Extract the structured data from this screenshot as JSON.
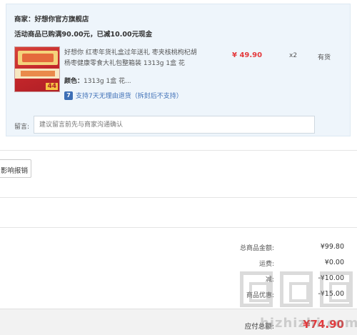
{
  "shop": {
    "name": "商家：好想你官方旗舰店",
    "promo": "活动商品已购满90.00元，已减10.00元现金"
  },
  "item": {
    "thumb_tag": "44",
    "title": "好想你 红枣年货礼盒过年送礼 枣夹核桃枸杞胡杨枣健康零食大礼包整箱装 1313g 1盒 花",
    "price": "¥ 49.90",
    "quantity": "x2",
    "stock": "有货",
    "color_label": "颜色：",
    "color_value": "1313g 1盒 花...",
    "return_icon": "7",
    "return_policy": "支持7天无理由退货（拆封后不支持）"
  },
  "message": {
    "label": "留言:",
    "placeholder": "建议留言前先与商家沟通确认"
  },
  "invoice": {
    "button_label": "影响报销"
  },
  "summary": {
    "goods_total_label": "总商品金额:",
    "goods_total_value": "¥99.80",
    "shipping_label": "运费:",
    "shipping_value": "¥0.00",
    "discount_label": "减:",
    "discount_value": "-¥10.00",
    "coupon_label": "商品优惠:",
    "coupon_value": "-¥15.00",
    "payable_label": "应付总额:",
    "payable_value": "¥74.90"
  },
  "watermark": {
    "text": "hizhizhi.com"
  },
  "colors": {
    "accent_red": "#e4393c",
    "link_blue": "#3d6fb6",
    "shop_box_bg": "#eef5fb"
  }
}
